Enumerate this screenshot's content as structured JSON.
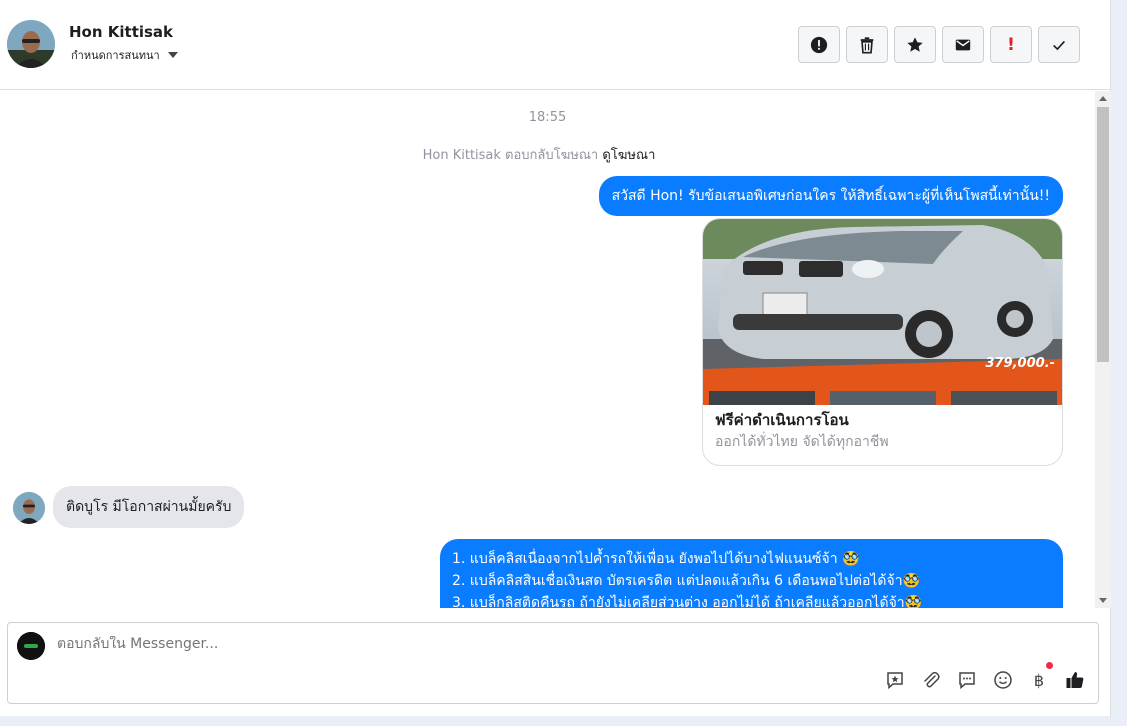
{
  "header": {
    "contact_name": "Hon Kittisak",
    "subtitle": "กำหนดการสนทนา",
    "tools": [
      {
        "icon": "alert-circle-icon"
      },
      {
        "icon": "trash-icon"
      },
      {
        "icon": "star-icon"
      },
      {
        "icon": "envelope-icon"
      },
      {
        "icon": "exclamation-icon",
        "label": "!"
      },
      {
        "icon": "check-icon"
      }
    ]
  },
  "conversation": {
    "timestamp": "18:55",
    "reply_notice": {
      "prefix": "Hon Kittisak ตอบกลับโฆษณา",
      "link": "ดูโฆษณา"
    },
    "messages": [
      {
        "direction": "outgoing",
        "text": "สวัสดี Hon! รับข้อเสนอพิเศษก่อนใคร  ให้สิทธิ์เฉพาะผู้ที่เห็นโพสนี้เท่านั้น!!"
      },
      {
        "direction": "outgoing",
        "type": "card",
        "price": "379,000.-",
        "title": "ฟรีค่าดำเนินการโอน",
        "description": "ออกได้ทั่วไทย จัดได้ทุกอาชีพ"
      },
      {
        "direction": "incoming",
        "text": "ติดบูโร มีโอกาสผ่านมั้ยครับ"
      },
      {
        "direction": "outgoing",
        "lines": [
          "1. แบล็คลิสเนื่องจากไปค้ำรถให้เพื่อน ยังพอไปได้บางไฟแนนซ์จ้า 🥸",
          "2. แบล็คลิสสินเชื่อเงินสด บัตรเครดิต แต่ปลดแล้วเกิน 6 เดือนพอไปต่อได้จ้า🥸",
          "3. แบล็กลิสติดคืนรถ ถ้ายังไม่เคลียส่วนต่าง ออกไม่ได้ ถ้าเคลียแล้วออกได้จ้า🥸"
        ]
      }
    ]
  },
  "composer": {
    "placeholder": "ตอบกลับใน Messenger...",
    "icons": [
      "sticker-comment-icon",
      "paperclip-icon",
      "chat-bubble-icon",
      "smiley-icon",
      "baht-icon",
      "thumbs-up-icon"
    ],
    "baht_label": "฿"
  },
  "colors": {
    "outgoing_bubble": "#0a7cff",
    "incoming_bubble": "#e4e6eb",
    "notification_dot": "#f02849",
    "exclamation": "#e02020"
  }
}
